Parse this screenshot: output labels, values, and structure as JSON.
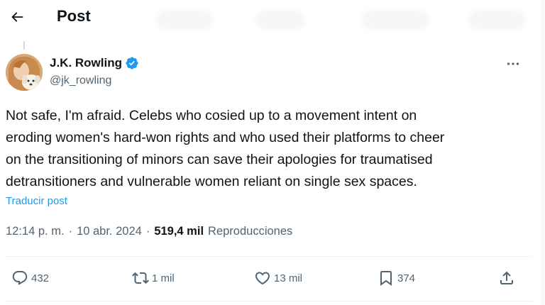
{
  "header": {
    "title": "Post"
  },
  "post": {
    "author_name": "J.K. Rowling",
    "handle": "@jk_rowling",
    "text": "Not safe, I'm afraid. Celebs who cosied up to a movement intent on\neroding women's hard-won rights and who used their platforms to cheer\non the transitioning of minors can save their apologies for traumatised\ndetransitioners and vulnerable women reliant on single sex spaces.",
    "translate_label": "Traducir post",
    "time": "12:14 p. m.",
    "sep1": "·",
    "date": "10 abr. 2024",
    "sep2": "·",
    "views_count": "519,4 mil",
    "views_label": "Reproducciones"
  },
  "actions": {
    "replies": "432",
    "reposts": "1 mil",
    "likes": "13 mil",
    "bookmarks": "374"
  },
  "colors": {
    "accent": "#1d9bf0",
    "text_primary": "#0f1419",
    "text_secondary": "#536471",
    "divider": "#eff3f4"
  }
}
